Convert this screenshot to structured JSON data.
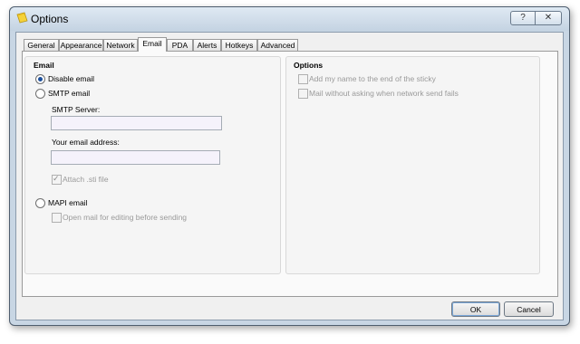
{
  "window": {
    "title": "Options",
    "help_label": "?",
    "close_label": "✕"
  },
  "tabs": [
    "General",
    "Appearance",
    "Network",
    "Email",
    "PDA",
    "Alerts",
    "Hotkeys",
    "Advanced"
  ],
  "active_tab": "Email",
  "email_group": {
    "title": "Email",
    "disable_email_label": "Disable email",
    "smtp_email_label": "SMTP email",
    "smtp_server_label": "SMTP Server:",
    "smtp_server_value": "",
    "email_address_label": "Your email address:",
    "email_address_value": "",
    "attach_sti_label": "Attach .sti file",
    "mapi_email_label": "MAPI email",
    "open_mail_label": "Open mail for editing before sending",
    "selected": "Disable email"
  },
  "options_group": {
    "title": "Options",
    "add_name_label": "Add my name to the end of the sticky",
    "mail_without_asking_label": "Mail without asking when network send fails"
  },
  "buttons": {
    "ok": "OK",
    "cancel": "Cancel"
  },
  "colors": {
    "selected_radio": "#1c4f9c",
    "window_frame": "#c8d6e4"
  },
  "icons": {
    "app": "sticky-note-icon"
  }
}
